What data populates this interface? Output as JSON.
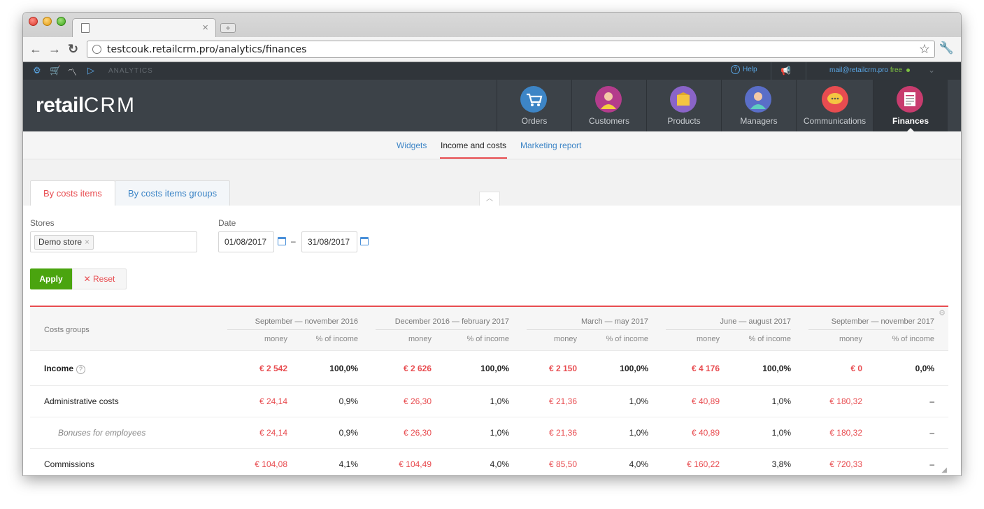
{
  "browser": {
    "url": "testcouk.retailcrm.pro/analytics/finances",
    "tab_close": "×",
    "new_tab": "+"
  },
  "appbar": {
    "section": "ANALYTICS",
    "help": "Help",
    "email": "mail@retailcrm.pro",
    "plan": "free"
  },
  "header": {
    "logo_prefix": "retail",
    "logo_suffix": "CRM",
    "nav": [
      {
        "label": "Orders",
        "icon": "cart-icon",
        "color": "#3d85c6"
      },
      {
        "label": "Customers",
        "icon": "customer-avatar-icon",
        "color": "#b43c8c"
      },
      {
        "label": "Products",
        "icon": "box-icon",
        "color": "#8a64c8"
      },
      {
        "label": "Managers",
        "icon": "manager-avatar-icon",
        "color": "#5a6ec8"
      },
      {
        "label": "Communications",
        "icon": "chat-bubble-icon",
        "color": "#e84c50"
      },
      {
        "label": "Finances",
        "icon": "report-sheet-icon",
        "color": "#c83c6e"
      }
    ]
  },
  "subnav": {
    "widgets": "Widgets",
    "income_costs": "Income and costs",
    "marketing": "Marketing report"
  },
  "tabs": {
    "by_items": "By costs items",
    "by_groups": "By costs items groups"
  },
  "filters": {
    "stores_label": "Stores",
    "store_chip": "Demo store",
    "date_label": "Date",
    "date_from": "01/08/2017",
    "date_to": "31/08/2017",
    "dash": "–",
    "apply": "Apply",
    "reset": "Reset"
  },
  "table": {
    "group_header": "Costs groups",
    "money_header": "money",
    "pct_header": "% of income",
    "periods": [
      "September — november 2016",
      "December 2016 — february 2017",
      "March — may 2017",
      "June — august 2017",
      "September — november 2017"
    ],
    "rows": [
      {
        "name": "Income",
        "style": "bold",
        "money": [
          "€ 2 542",
          "€ 2 626",
          "€ 2 150",
          "€ 4 176",
          "€ 0"
        ],
        "pct": [
          "100,0%",
          "100,0%",
          "100,0%",
          "100,0%",
          "0,0%"
        ]
      },
      {
        "name": "Administrative costs",
        "style": "normal",
        "money": [
          "€ 24,14",
          "€ 26,30",
          "€ 21,36",
          "€ 40,89",
          "€ 180,32"
        ],
        "pct": [
          "0,9%",
          "1,0%",
          "1,0%",
          "1,0%",
          "–"
        ]
      },
      {
        "name": "Bonuses for employees",
        "style": "sub",
        "money": [
          "€ 24,14",
          "€ 26,30",
          "€ 21,36",
          "€ 40,89",
          "€ 180,32"
        ],
        "pct": [
          "0,9%",
          "1,0%",
          "1,0%",
          "1,0%",
          "–"
        ]
      },
      {
        "name": "Commissions",
        "style": "normal",
        "money": [
          "€ 104,08",
          "€ 104,49",
          "€ 85,50",
          "€ 160,22",
          "€ 720,33"
        ],
        "pct": [
          "4,1%",
          "4,0%",
          "4,0%",
          "3,8%",
          "–"
        ]
      }
    ]
  }
}
